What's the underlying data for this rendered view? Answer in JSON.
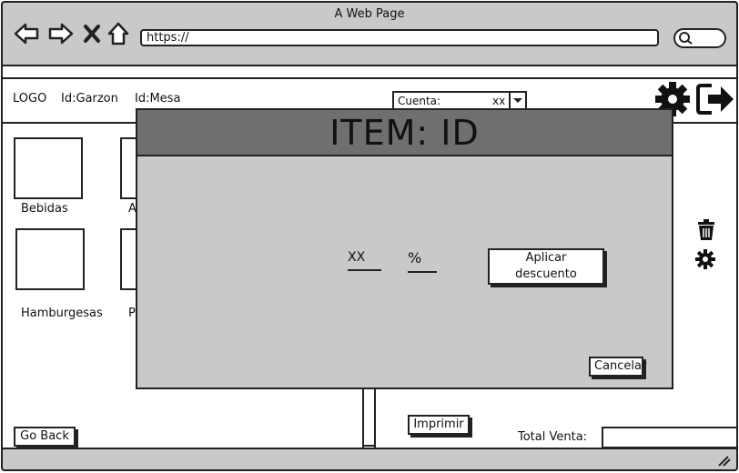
{
  "browser": {
    "window_title": "A Web Page",
    "url": "https://"
  },
  "header": {
    "logo": "LOGO",
    "waiter": "Id:Garzon",
    "table": "Id:Mesa",
    "account_select": {
      "label": "Cuenta:",
      "value": "xx"
    }
  },
  "categories": [
    {
      "label": "Bebidas"
    },
    {
      "label": "A"
    },
    {
      "label": "Hamburgesas"
    },
    {
      "label": "P"
    }
  ],
  "modal": {
    "title": "ITEM: ID",
    "discount_value": "XX",
    "percent_symbol": "%",
    "apply_button": "Aplicar descuento",
    "cancel_button": "Cancelar"
  },
  "footer": {
    "back_button": "Go Back",
    "print_button": "Imprimir",
    "total_label": "Total Venta:"
  },
  "icons": {
    "gear": "gear-icon",
    "logout": "logout-icon",
    "trash": "trash-icon",
    "settings": "settings-icon"
  }
}
